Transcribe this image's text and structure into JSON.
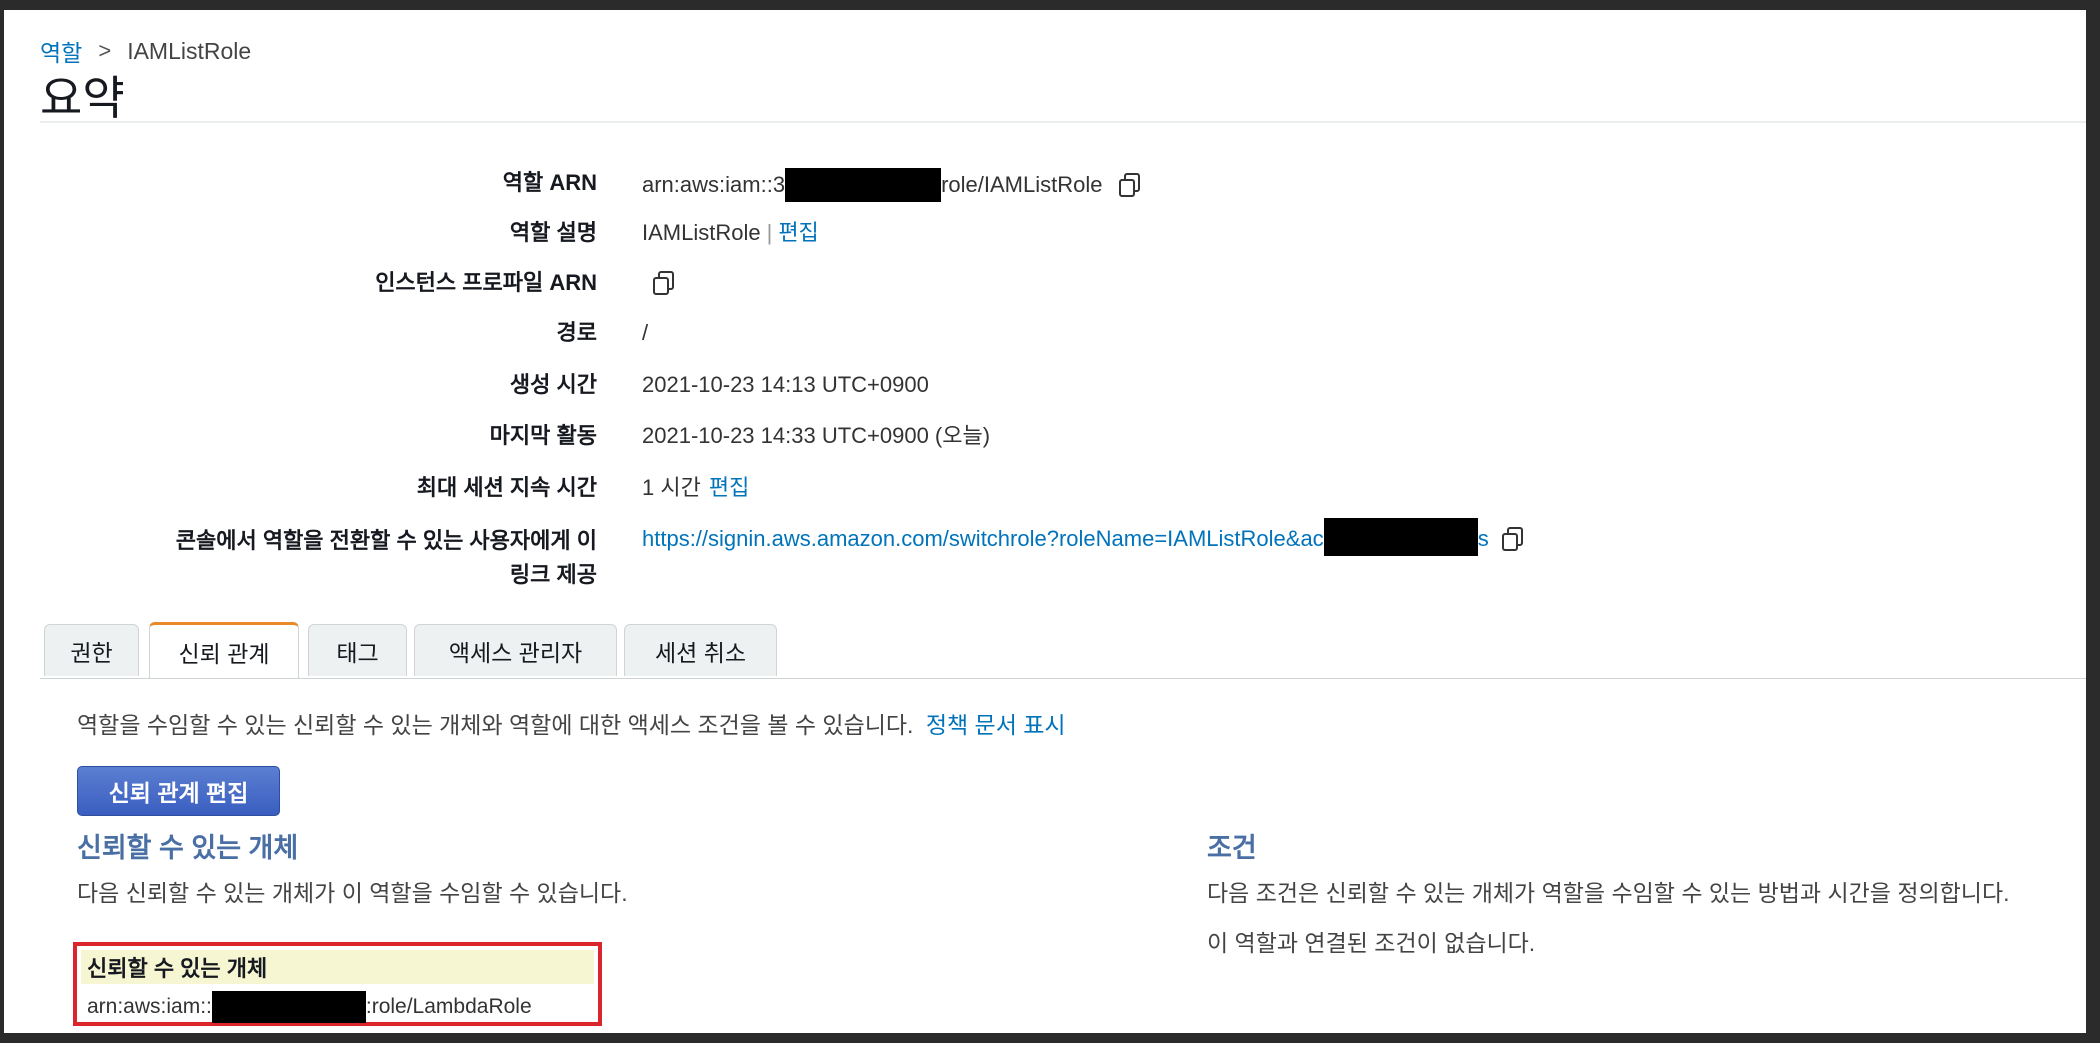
{
  "breadcrumb": {
    "parent": "역할",
    "separator": ">",
    "current": "IAMListRole"
  },
  "page_title": "요약",
  "summary": {
    "role_arn": {
      "label": "역할 ARN",
      "prefix": "arn:aws:iam::3",
      "suffix": "role/IAMListRole"
    },
    "description": {
      "label": "역할 설명",
      "value": "IAMListRole",
      "pipe": "|",
      "edit": "편집"
    },
    "instance_profile": {
      "label": "인스턴스 프로파일 ARN"
    },
    "path": {
      "label": "경로",
      "value": "/"
    },
    "created": {
      "label": "생성 시간",
      "value": "2021-10-23 14:13 UTC+0900"
    },
    "last_activity": {
      "label": "마지막 활동",
      "value": "2021-10-23 14:33 UTC+0900 (오늘)"
    },
    "max_session": {
      "label": "최대 세션 지속 시간",
      "value": "1 시간",
      "edit": "편집"
    },
    "switch_link": {
      "label_line1": "콘솔에서 역할을 전환할 수 있는 사용자에게 이",
      "label_line2": "링크 제공",
      "value_prefix": "https://signin.aws.amazon.com/switchrole?roleName=IAMListRole&ac",
      "value_suffix": "s"
    }
  },
  "tabs": [
    {
      "label": "권한",
      "active": false
    },
    {
      "label": "신뢰 관계",
      "active": true
    },
    {
      "label": "태그",
      "active": false
    },
    {
      "label": "액세스 관리자",
      "active": false
    },
    {
      "label": "세션 취소",
      "active": false
    }
  ],
  "trust_panel": {
    "description": "역할을 수임할 수 있는 신뢰할 수 있는 개체와 역할에 대한 액세스 조건을 볼 수 있습니다.",
    "show_policy_link": "정책 문서 표시",
    "edit_button": "신뢰 관계 편집",
    "entities_title": "신뢰할 수 있는 개체",
    "entities_text": "다음 신뢰할 수 있는 개체가 이 역할을 수임할 수 있습니다.",
    "table_header": "신뢰할 수 있는 개체",
    "entity_prefix": "arn:aws:iam::",
    "entity_suffix": ":role/LambdaRole",
    "conditions_title": "조건",
    "conditions_text": "다음 조건은 신뢰할 수 있는 개체가 역할을 수임할 수 있는 방법과 시간을 정의합니다.",
    "no_conditions": "이 역할과 연결된 조건이 없습니다."
  },
  "colors": {
    "link": "#0073bb",
    "tab_active": "#e88a2b",
    "highlight_border": "#d9252b",
    "button": "#3a5ec0"
  }
}
